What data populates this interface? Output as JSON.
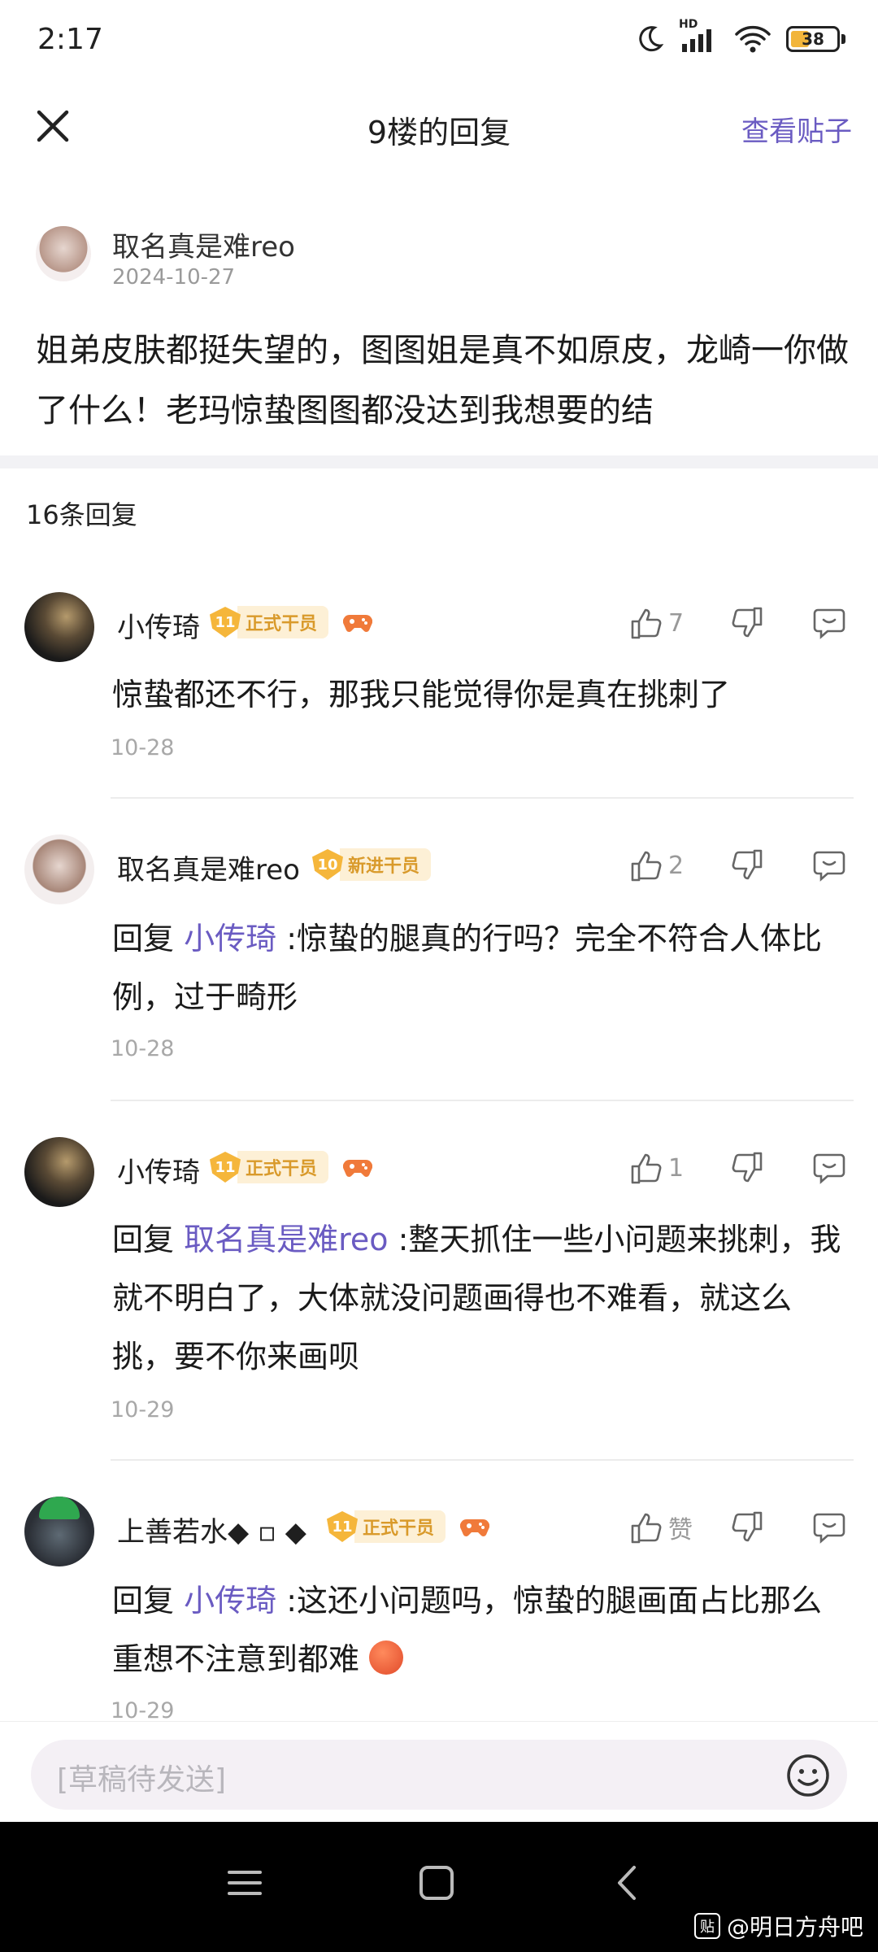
{
  "status_bar": {
    "time": "2:17",
    "battery": "38",
    "network": "HD"
  },
  "header": {
    "title": "9楼的回复",
    "view_post": "查看贴子"
  },
  "post": {
    "author": "取名真是难reo",
    "date": "2024-10-27",
    "text": "姐弟皮肤都挺失望的，图图姐是真不如原皮，龙崎一你做了什么！老玛惊蛰图图都没达到我想要的结"
  },
  "reply_count": "16条回复",
  "replies": [
    {
      "name": "小传琦",
      "level": "11",
      "title": "正式干员",
      "likes": "7",
      "prefix": "",
      "reply_to": "",
      "text": "惊蛰都还不行，那我只能觉得你是真在挑刺了",
      "date": "10-28"
    },
    {
      "name": "取名真是难reo",
      "level": "10",
      "title": "新进干员",
      "likes": "2",
      "prefix": "回复 ",
      "reply_to": "小传琦",
      "text": " :惊蛰的腿真的行吗？完全不符合人体比例，过于畸形",
      "date": "10-28"
    },
    {
      "name": "小传琦",
      "level": "11",
      "title": "正式干员",
      "likes": "1",
      "prefix": "回复 ",
      "reply_to": "取名真是难reo",
      "text": " :整天抓住一些小问题来挑刺，我就不明白了，大体就没问题画得也不难看，就这么挑，要不你来画呗",
      "date": "10-29"
    },
    {
      "name": "上善若水◆ ▫ ◆",
      "level": "11",
      "title": "正式干员",
      "likes": "赞",
      "prefix": "回复 ",
      "reply_to": "小传琦",
      "text": " :这还小问题吗，惊蛰的腿画面占比那么重想不注意到都难 ",
      "date": "10-29"
    }
  ],
  "input": {
    "placeholder": "[草稿待发送]"
  },
  "watermark": {
    "icon": "贴",
    "text": "@明日方舟吧"
  },
  "colors": {
    "accent": "#6a5bc2",
    "badge": "#f5b63b",
    "badge_bg": "#fdf0d6"
  }
}
